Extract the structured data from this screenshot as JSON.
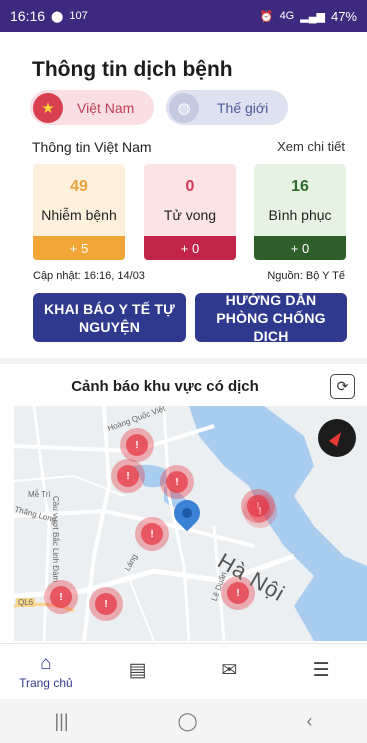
{
  "status_bar": {
    "time": "16:16",
    "notif_count": "107",
    "network": "4G",
    "battery": "47%"
  },
  "header": {
    "title": "Thông tin dịch bệnh"
  },
  "region_toggle": {
    "vietnam_label": "Việt Nam",
    "world_label": "Thế giới"
  },
  "vn_info": {
    "section_title": "Thông tin Việt Nam",
    "detail_link": "Xem chi tiết",
    "stats": [
      {
        "value": "49",
        "label": "Nhiễm bệnh",
        "delta": "+ 5"
      },
      {
        "value": "0",
        "label": "Tử vong",
        "delta": "+ 0"
      },
      {
        "value": "16",
        "label": "Bình phục",
        "delta": "+ 0"
      }
    ],
    "update_time": "Cập nhật: 16:16, 14/03",
    "source": "Nguồn: Bộ Y Tế"
  },
  "actions": {
    "declare_label": "KHAI BÁO Y TẾ TỰ NGUYỆN",
    "guide_label": "HƯỚNG DẪN PHÒNG CHỐNG DỊCH"
  },
  "map": {
    "title": "Cảnh báo khu vực có dịch",
    "city_label": "Hà Nội",
    "street_labels": [
      "Hoàng Quốc Việt",
      "Mễ Trì",
      "Cầu vượt Bắc Linh Đàm",
      "Thăng Long",
      "QL6",
      "Lê Duẩn",
      "Láng"
    ],
    "hotspot_count": 9
  },
  "bottom_nav": {
    "items": [
      {
        "label": "Trang chủ",
        "icon": "home-icon"
      },
      {
        "label": "",
        "icon": "chart-icon"
      },
      {
        "label": "",
        "icon": "message-icon"
      },
      {
        "label": "",
        "icon": "menu-icon"
      }
    ]
  },
  "colors": {
    "status_bar": "#3d2a7e",
    "primary_button": "#2f3a8f",
    "infected": "#f1a637",
    "death": "#c2244a",
    "recovered": "#2e5f2a"
  }
}
